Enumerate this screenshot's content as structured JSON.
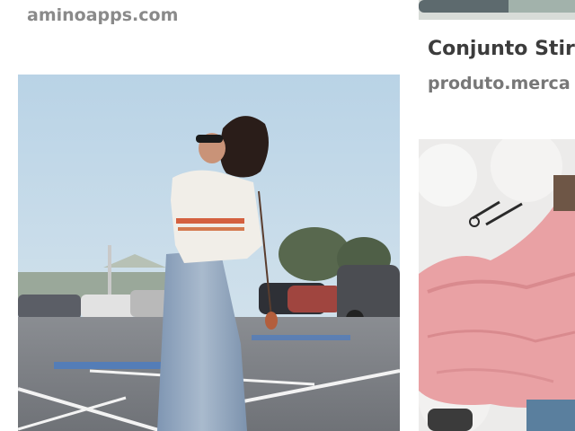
{
  "results": [
    {
      "source": "aminoapps.com",
      "image_alt": "woman in striped sweater and wide-leg jeans standing in a parking lot"
    },
    {
      "title": "Conjunto Stir",
      "source": "produto.merca",
      "image_alt": "pink ruffled top laid on a white fur surface with sunglasses"
    }
  ],
  "colors": {
    "source_text": "#8a8a8a",
    "title_text": "#3c3c3c",
    "background": "#ffffff"
  }
}
